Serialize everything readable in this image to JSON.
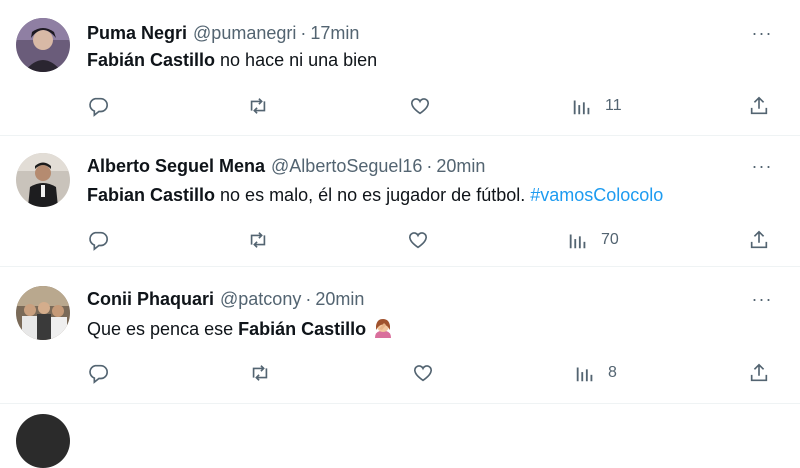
{
  "tweets": [
    {
      "name": "Puma Negri",
      "handle": "@pumanegri",
      "dot": "·",
      "time": "17min",
      "text_bold": "Fabián Castillo",
      "text_rest": " no hace ni una bien",
      "hashtag": "",
      "views": "11"
    },
    {
      "name": "Alberto Seguel Mena",
      "handle": "@AlbertoSeguel16",
      "dot": "·",
      "time": "20min",
      "text_bold": "Fabian Castillo",
      "text_rest": " no es malo, él no es jugador de fútbol. ",
      "hashtag": "#vamosColocolo",
      "views": "70"
    },
    {
      "name": "Conii Phaquari",
      "handle": "@patcony",
      "dot": "·",
      "time": "20min",
      "text_pre": "Que es penca ese ",
      "text_bold": "Fabián Castillo",
      "emoji": "face-palm-emoji",
      "views": "8"
    }
  ],
  "more_label": "···",
  "colors": {
    "text": "#0f1419",
    "secondary": "#536471",
    "link": "#1d9bf0",
    "divider": "#eff3f4"
  }
}
